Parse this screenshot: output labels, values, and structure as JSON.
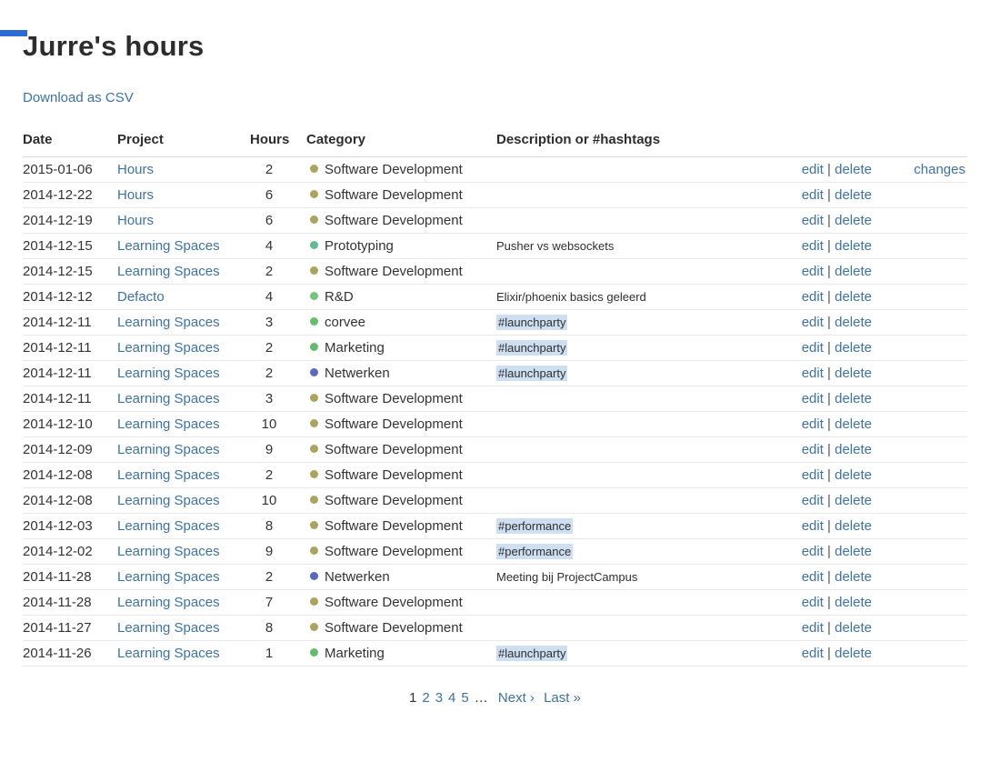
{
  "colors": {
    "link": "#3d72a4",
    "hashtag_highlight": "#cddff0",
    "corner_accent": "#2b6cd4"
  },
  "page": {
    "title": "Jurre's hours",
    "download_link": "Download as CSV"
  },
  "table": {
    "headers": [
      "Date",
      "Project",
      "Hours",
      "Category",
      "Description or #hashtags"
    ],
    "actions": {
      "edit": "edit",
      "separator": "|",
      "delete": "delete",
      "changes": "changes"
    },
    "category_colors": {
      "Software Development": "#aaa45f",
      "Prototyping": "#63bb90",
      "R&D": "#74c479",
      "corvee": "#69bd6f",
      "Marketing": "#64bb6c",
      "Netwerken": "#5b68c0"
    },
    "rows": [
      {
        "date": "2015-01-06",
        "project": "Hours",
        "hours": "2",
        "category": "Software Development",
        "description": "",
        "highlight": false,
        "has_changes": true
      },
      {
        "date": "2014-12-22",
        "project": "Hours",
        "hours": "6",
        "category": "Software Development",
        "description": "",
        "highlight": false,
        "has_changes": false
      },
      {
        "date": "2014-12-19",
        "project": "Hours",
        "hours": "6",
        "category": "Software Development",
        "description": "",
        "highlight": false,
        "has_changes": false
      },
      {
        "date": "2014-12-15",
        "project": "Learning Spaces",
        "hours": "4",
        "category": "Prototyping",
        "description": "Pusher vs websockets",
        "highlight": false,
        "has_changes": false
      },
      {
        "date": "2014-12-15",
        "project": "Learning Spaces",
        "hours": "2",
        "category": "Software Development",
        "description": "",
        "highlight": false,
        "has_changes": false
      },
      {
        "date": "2014-12-12",
        "project": "Defacto",
        "hours": "4",
        "category": "R&D",
        "description": "Elixir/phoenix basics geleerd",
        "highlight": false,
        "has_changes": false
      },
      {
        "date": "2014-12-11",
        "project": "Learning Spaces",
        "hours": "3",
        "category": "corvee",
        "description": "#launchparty",
        "highlight": true,
        "has_changes": false
      },
      {
        "date": "2014-12-11",
        "project": "Learning Spaces",
        "hours": "2",
        "category": "Marketing",
        "description": "#launchparty",
        "highlight": true,
        "has_changes": false
      },
      {
        "date": "2014-12-11",
        "project": "Learning Spaces",
        "hours": "2",
        "category": "Netwerken",
        "description": "#launchparty",
        "highlight": true,
        "has_changes": false
      },
      {
        "date": "2014-12-11",
        "project": "Learning Spaces",
        "hours": "3",
        "category": "Software Development",
        "description": "",
        "highlight": false,
        "has_changes": false
      },
      {
        "date": "2014-12-10",
        "project": "Learning Spaces",
        "hours": "10",
        "category": "Software Development",
        "description": "",
        "highlight": false,
        "has_changes": false
      },
      {
        "date": "2014-12-09",
        "project": "Learning Spaces",
        "hours": "9",
        "category": "Software Development",
        "description": "",
        "highlight": false,
        "has_changes": false
      },
      {
        "date": "2014-12-08",
        "project": "Learning Spaces",
        "hours": "2",
        "category": "Software Development",
        "description": "",
        "highlight": false,
        "has_changes": false
      },
      {
        "date": "2014-12-08",
        "project": "Learning Spaces",
        "hours": "10",
        "category": "Software Development",
        "description": "",
        "highlight": false,
        "has_changes": false
      },
      {
        "date": "2014-12-03",
        "project": "Learning Spaces",
        "hours": "8",
        "category": "Software Development",
        "description": "#performance",
        "highlight": true,
        "has_changes": false
      },
      {
        "date": "2014-12-02",
        "project": "Learning Spaces",
        "hours": "9",
        "category": "Software Development",
        "description": "#performance",
        "highlight": true,
        "has_changes": false
      },
      {
        "date": "2014-11-28",
        "project": "Learning Spaces",
        "hours": "2",
        "category": "Netwerken",
        "description": "Meeting bij ProjectCampus",
        "highlight": false,
        "has_changes": false
      },
      {
        "date": "2014-11-28",
        "project": "Learning Spaces",
        "hours": "7",
        "category": "Software Development",
        "description": "",
        "highlight": false,
        "has_changes": false
      },
      {
        "date": "2014-11-27",
        "project": "Learning Spaces",
        "hours": "8",
        "category": "Software Development",
        "description": "",
        "highlight": false,
        "has_changes": false
      },
      {
        "date": "2014-11-26",
        "project": "Learning Spaces",
        "hours": "1",
        "category": "Marketing",
        "description": "#launchparty",
        "highlight": true,
        "has_changes": false
      }
    ]
  },
  "pagination": {
    "current": "1",
    "pages": [
      "2",
      "3",
      "4",
      "5"
    ],
    "ellipsis": "…",
    "next": "Next ›",
    "last": "Last »"
  }
}
